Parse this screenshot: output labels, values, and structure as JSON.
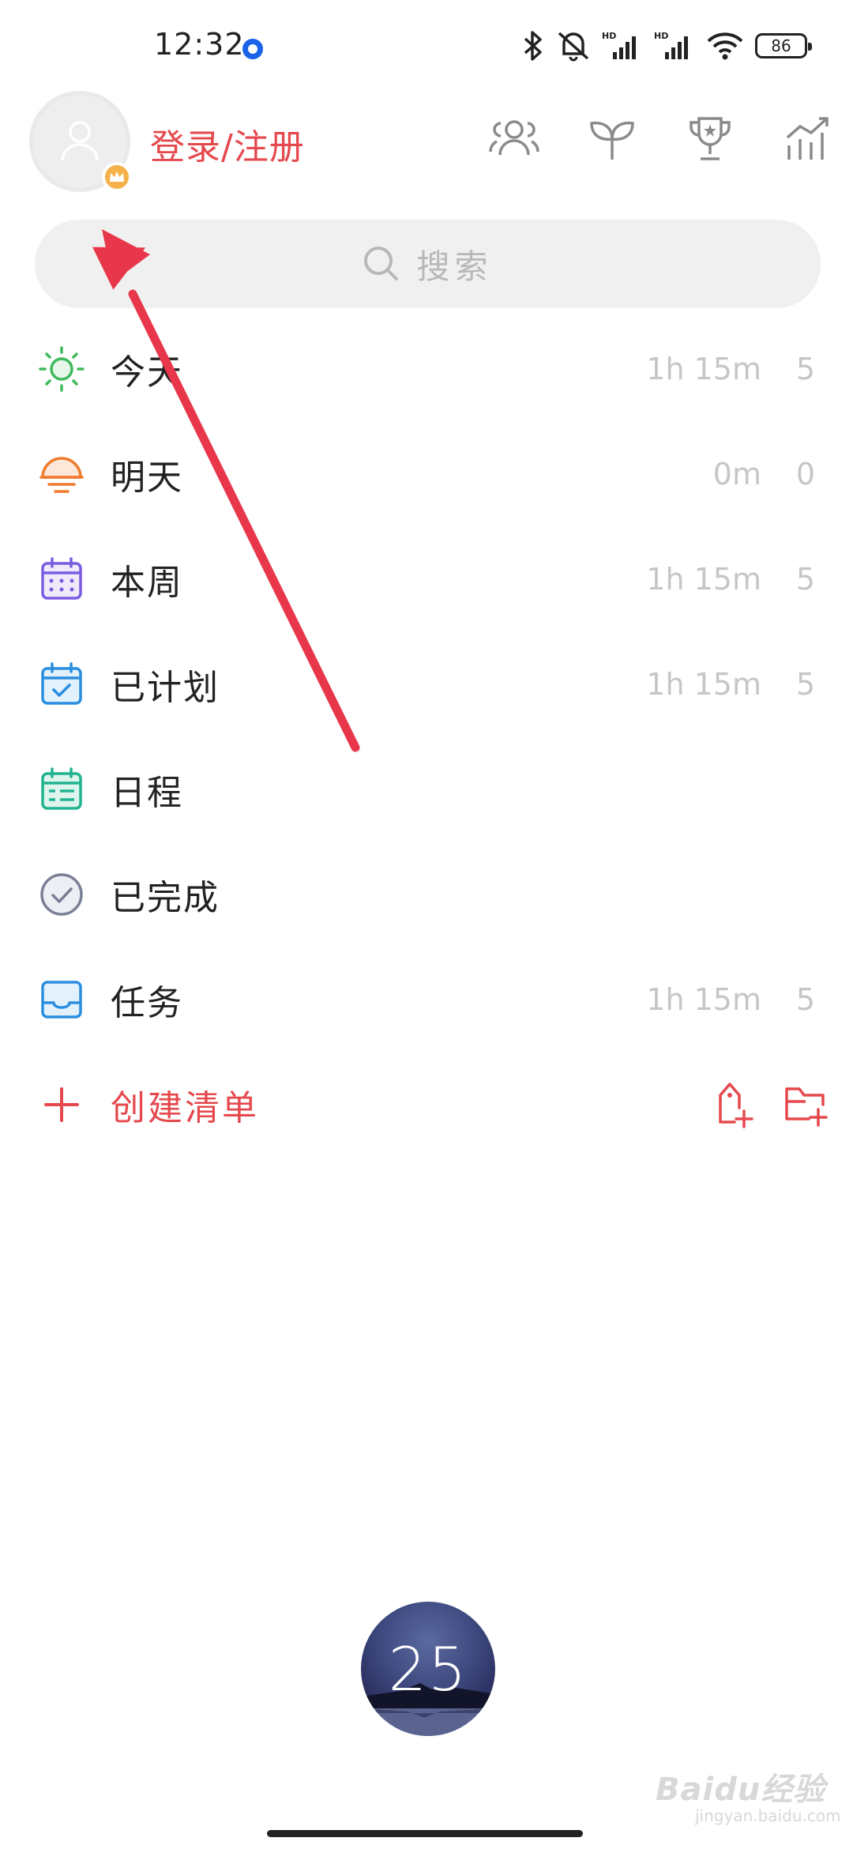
{
  "status_bar": {
    "time": "12:32",
    "battery": "86"
  },
  "header": {
    "login_label": "登录/注册"
  },
  "search": {
    "placeholder": "搜索"
  },
  "menu": [
    {
      "label": "今天",
      "duration": "1h 15m",
      "count": "5",
      "icon": "sun-icon",
      "color": "#3fba5b"
    },
    {
      "label": "明天",
      "duration": "0m",
      "count": "0",
      "icon": "sunrise-icon",
      "color": "#f07b2e"
    },
    {
      "label": "本周",
      "duration": "1h 15m",
      "count": "5",
      "icon": "calendar-week-icon",
      "color": "#7b5ce0"
    },
    {
      "label": "已计划",
      "duration": "1h 15m",
      "count": "5",
      "icon": "calendar-check-icon",
      "color": "#2a8ee0"
    },
    {
      "label": "日程",
      "duration": "",
      "count": "",
      "icon": "calendar-schedule-icon",
      "color": "#21b38f"
    },
    {
      "label": "已完成",
      "duration": "",
      "count": "",
      "icon": "check-circle-icon",
      "color": "#7a7f96"
    },
    {
      "label": "任务",
      "duration": "1h 15m",
      "count": "5",
      "icon": "inbox-icon",
      "color": "#2a8ee0"
    }
  ],
  "create": {
    "label": "创建清单"
  },
  "pomodoro": {
    "count": "25"
  },
  "watermark": {
    "brand": "Baidu经验",
    "url": "jingyan.baidu.com"
  },
  "colors": {
    "accent": "#e5484d",
    "muted": "#c6c6c6"
  }
}
